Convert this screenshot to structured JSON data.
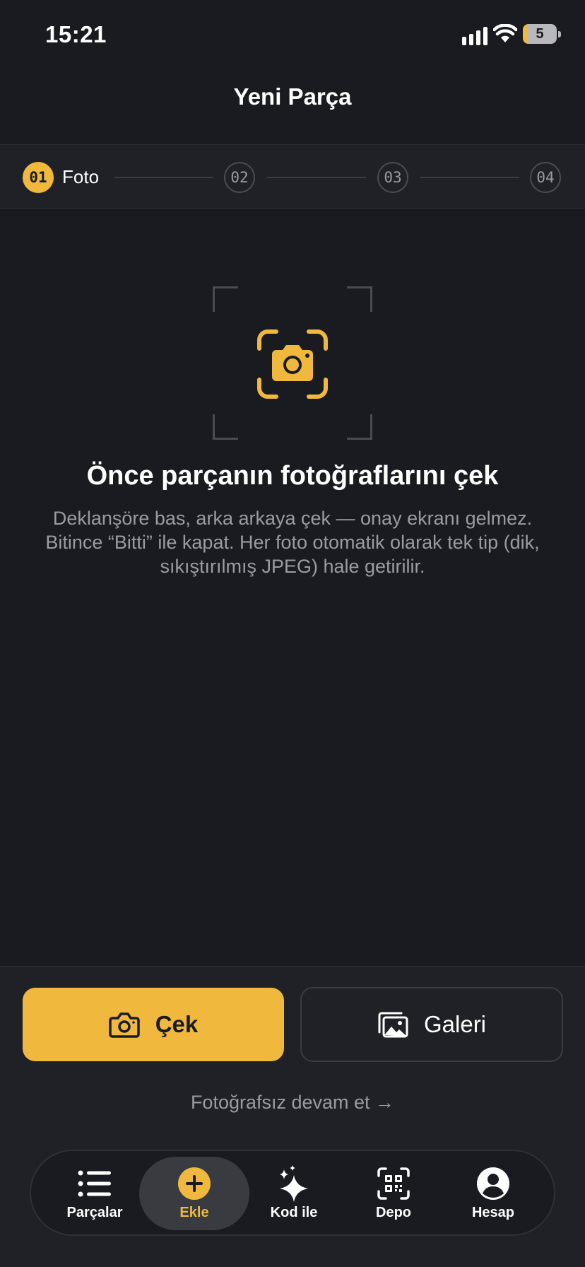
{
  "status_bar": {
    "time": "15:21",
    "battery": "5"
  },
  "header": {
    "title": "Yeni Parça"
  },
  "stepper": {
    "steps": [
      {
        "number": "01",
        "label": "Foto"
      },
      {
        "number": "02"
      },
      {
        "number": "03"
      },
      {
        "number": "04"
      }
    ]
  },
  "main": {
    "title": "Önce parçanın fotoğraflarını çek",
    "description": "Deklanşöre bas, arka arkaya çek — onay ekranı gelmez. Bitince “Bitti” ile kapat. Her foto otomatik olarak tek tip (dik, sıkıştırılmış JPEG) hale getirilir."
  },
  "actions": {
    "capture_label": "Çek",
    "gallery_label": "Galeri",
    "skip_label": "Fotoğrafsız devam et →"
  },
  "tab_bar": {
    "items": [
      {
        "label": "Parçalar",
        "icon": "list-icon"
      },
      {
        "label": "Ekle",
        "icon": "plus-circle-icon"
      },
      {
        "label": "Kod ile",
        "icon": "sparkles-icon"
      },
      {
        "label": "Depo",
        "icon": "qr-scan-icon"
      },
      {
        "label": "Hesap",
        "icon": "account-icon"
      }
    ]
  },
  "colors": {
    "accent": "#f0b93e",
    "background": "#1a1b20",
    "muted_text": "#9a9ca3"
  }
}
